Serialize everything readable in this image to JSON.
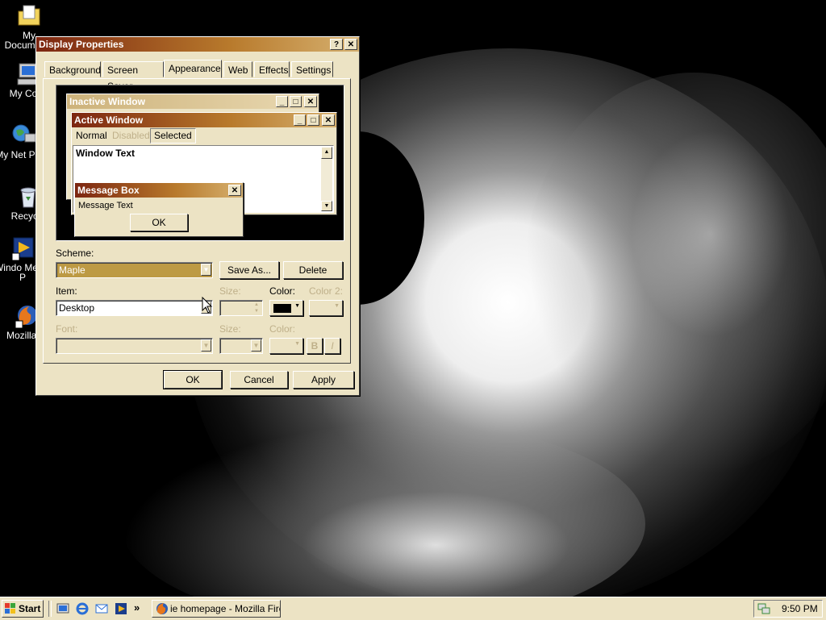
{
  "desktop_icons": [
    {
      "label": "My Documents",
      "icon": "folder-documents-icon"
    },
    {
      "label": "My Com",
      "icon": "my-computer-icon"
    },
    {
      "label": "My Net Place",
      "icon": "network-places-icon"
    },
    {
      "label": "Recycle",
      "icon": "recycle-bin-icon"
    },
    {
      "label": "Windo Media P",
      "icon": "media-player-icon"
    },
    {
      "label": "Mozilla F",
      "icon": "firefox-icon"
    }
  ],
  "dialog": {
    "title": "Display Properties",
    "help_glyph": "?",
    "close_glyph": "✕",
    "tabs": [
      "Background",
      "Screen Saver",
      "Appearance",
      "Web",
      "Effects",
      "Settings"
    ],
    "active_tab": "Appearance",
    "preview": {
      "inactive_title": "Inactive Window",
      "active_title": "Active Window",
      "menu": [
        "Normal",
        "Disabled",
        "Selected"
      ],
      "window_text": "Window Text",
      "msgbox_title": "Message Box",
      "msgbox_text": "Message Text",
      "msgbox_ok": "OK"
    },
    "scheme_label": "Scheme:",
    "scheme_value": "Maple",
    "save_as": "Save As...",
    "delete": "Delete",
    "item_label": "Item:",
    "item_value": "Desktop",
    "size_label": "Size:",
    "color_label": "Color:",
    "color2_label": "Color 2:",
    "font_label": "Font:",
    "font_size_label": "Size:",
    "font_color_label": "Color:",
    "bold_glyph": "B",
    "italic_glyph": "I",
    "ok": "OK",
    "cancel": "Cancel",
    "apply": "Apply"
  },
  "taskbar": {
    "start": "Start",
    "chevron": "»",
    "task": "ie homepage - Mozilla Firefox",
    "clock": "9:50 PM"
  },
  "colors": {
    "accent_dark": "#7c2510",
    "accent_light": "#d6b170",
    "face": "#ece3c4",
    "selection": "#bd9a44"
  }
}
